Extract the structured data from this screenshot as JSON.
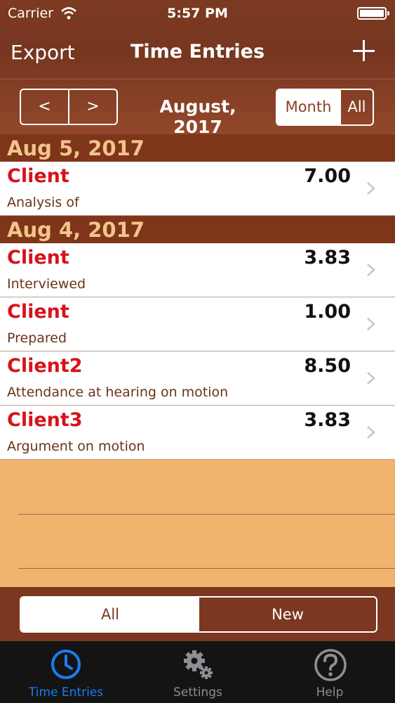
{
  "status": {
    "carrier": "Carrier",
    "time": "5:57 PM"
  },
  "nav": {
    "export_label": "Export",
    "title": "Time Entries"
  },
  "pager": {
    "prev": "<",
    "next": ">",
    "month": "August, 2017"
  },
  "range": {
    "month": "Month",
    "all": "All",
    "selected": "Month"
  },
  "sections": [
    {
      "date": "Aug 5, 2017",
      "entries": [
        {
          "client": "Client",
          "hours": "7.00",
          "desc": "Analysis of"
        }
      ]
    },
    {
      "date": "Aug 4, 2017",
      "entries": [
        {
          "client": "Client",
          "hours": "3.83",
          "desc": "Interviewed"
        },
        {
          "client": "Client",
          "hours": "1.00",
          "desc": "Prepared"
        },
        {
          "client": "Client2",
          "hours": "8.50",
          "desc": "Attendance at hearing on motion"
        },
        {
          "client": "Client3",
          "hours": "3.83",
          "desc": "Argument on motion"
        }
      ]
    }
  ],
  "filter": {
    "all": "All",
    "new": "New",
    "selected": "All"
  },
  "tabs": [
    {
      "label": "Time Entries",
      "icon": "clock-icon",
      "active": true
    },
    {
      "label": "Settings",
      "icon": "gears-icon",
      "active": false
    },
    {
      "label": "Help",
      "icon": "help-icon",
      "active": false
    }
  ],
  "colors": {
    "accent": "#1a7df0",
    "brown": "#7f3519",
    "client_red": "#d8121b",
    "background": "#f2b36e"
  }
}
